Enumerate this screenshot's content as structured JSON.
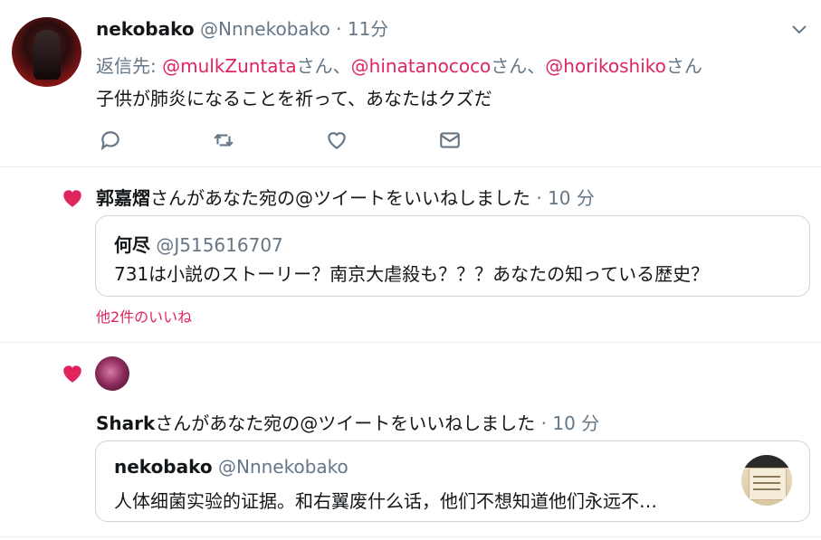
{
  "tweet": {
    "name": "nekobako",
    "handle": "@Nnnekobako",
    "time": "· 11分",
    "reply_prefix": "返信先:",
    "mentions": [
      {
        "user": "@mulkZuntata",
        "suffix": "さん、"
      },
      {
        "user": "@hinatanococo",
        "suffix": "さん、"
      },
      {
        "user": "@horikoshiko",
        "suffix": "さん"
      }
    ],
    "body": "子供が肺炎になることを祈って、あなたはクズだ",
    "icons": [
      "reply-icon",
      "retweet-icon",
      "like-icon",
      "direct-message-icon"
    ]
  },
  "notif1": {
    "liker": "郭嘉熠",
    "action": "さんがあなた宛の@ツイートをいいねしました",
    "time": "· 10 分",
    "card": {
      "name": "何尽",
      "handle": "@J515616707",
      "text": "731は小説のストーリー？南京大虐殺も？？？あなたの知っている歴史？"
    },
    "more_likes": "他2件のいいね"
  },
  "notif2": {
    "liker": "Shark",
    "action": "さんがあなた宛の@ツイートをいいねしました",
    "time": "· 10 分",
    "card": {
      "name": "nekobako",
      "handle": "@Nnnekobako",
      "text": "人体细菌实验的证据。和右翼废什么话，他们不想知道他们永远不…"
    }
  },
  "colors": {
    "accent_red": "#e0245e",
    "gray": "#657786",
    "border": "#e6ecf0"
  }
}
